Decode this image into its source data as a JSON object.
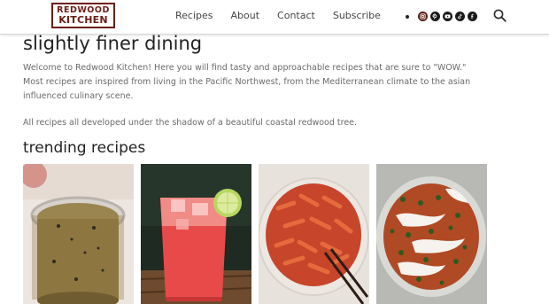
{
  "header": {
    "logo_line1": "REDWOOD",
    "logo_line2": "KITCHEN",
    "nav": [
      "Recipes",
      "About",
      "Contact",
      "Subscribe"
    ],
    "social_icons": [
      "instagram-icon",
      "pinterest-icon",
      "youtube-icon",
      "tiktok-icon",
      "facebook-icon"
    ],
    "search_icon": "search-icon",
    "brand_color": "#6b1e14"
  },
  "main": {
    "title": "slightly finer dining",
    "intro": "Welcome to Redwood Kitchen! Here you will find tasty and approachable recipes that are sure to \"WOW.\" Most recipes are inspired from living in the Pacific Northwest, from the Mediterranean climate to the asian influenced culinary scene.",
    "intro2": "All recipes all developed under the shadow of a beautiful coastal redwood tree.",
    "trending_title": "trending recipes"
  }
}
